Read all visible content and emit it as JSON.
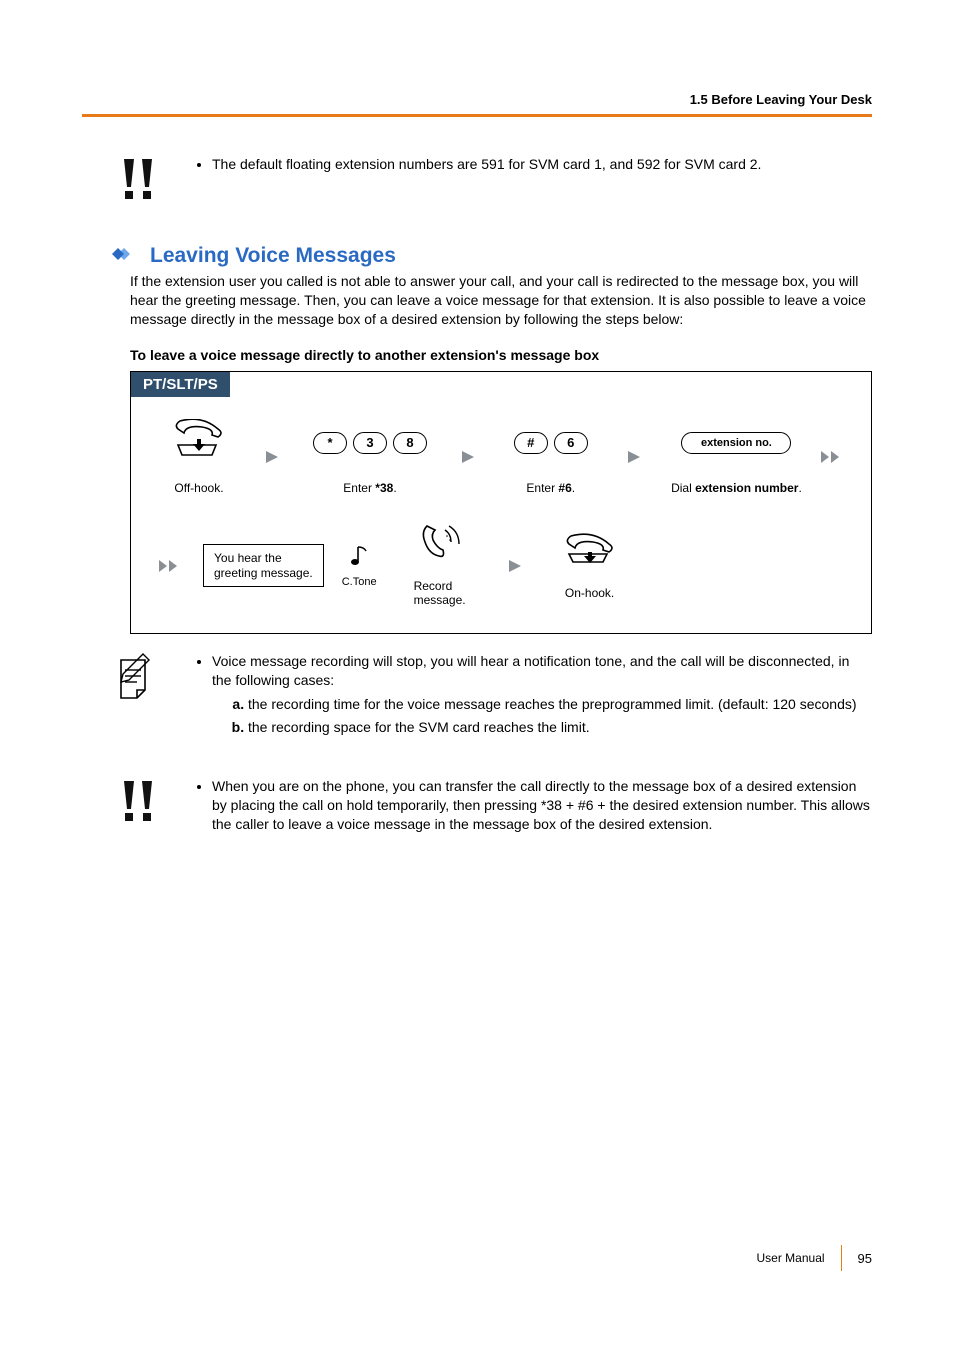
{
  "header": {
    "section_label": "1.5 Before Leaving Your Desk"
  },
  "callout_default_ext": {
    "text": "The default floating extension numbers are 591 for SVM card 1, and 592 for SVM card 2."
  },
  "section": {
    "title": "Leaving Voice Messages",
    "intro": "If the extension user you called is not able to answer your call, and your call is redirected to the message box, you will hear the greeting message. Then, you can leave a voice message for that extension. It is also possible to leave a voice message directly in the message box of a desired extension by following the steps below:",
    "subhead": "To leave a voice message directly to another extension's message box"
  },
  "flow": {
    "tab": "PT/SLT/PS",
    "row1": {
      "off_hook_label": "Off-hook.",
      "keys_38": [
        "*",
        "3",
        "8"
      ],
      "keys_38_label_prefix": "Enter ",
      "keys_38_label_code": "*38",
      "keys_38_label_suffix": ".",
      "keys_6": [
        "#",
        "6"
      ],
      "keys_6_label_prefix": "Enter ",
      "keys_6_label_code": "#6",
      "keys_6_label_suffix": ".",
      "ext_key": "extension no.",
      "ext_label_prefix": "Dial ",
      "ext_label_bold": "extension number",
      "ext_label_suffix": "."
    },
    "row2": {
      "greeting_l1": "You hear the",
      "greeting_l2": "greeting message.",
      "ctone_label": "C.Tone",
      "record_l1": "Record",
      "record_l2": "message.",
      "onhook_label": "On-hook."
    }
  },
  "note_recording": {
    "lead": "Voice message recording will stop, you will hear a notification tone, and the call will be disconnected, in the following cases:",
    "a": "the recording time for the voice message reaches the preprogrammed limit. (default: 120 seconds)",
    "b": "the recording space for the SVM card reaches the limit."
  },
  "callout_transfer": {
    "p1": "When you are on the phone, you can transfer the call directly to the message box of a desired extension by placing the call on hold temporarily, then pressing ",
    "code": "*38 + #6",
    "p2": " + the desired extension number. This allows the caller to leave a voice message in the message box of the desired extension."
  },
  "footer": {
    "doc": "User Manual",
    "page": "95"
  }
}
